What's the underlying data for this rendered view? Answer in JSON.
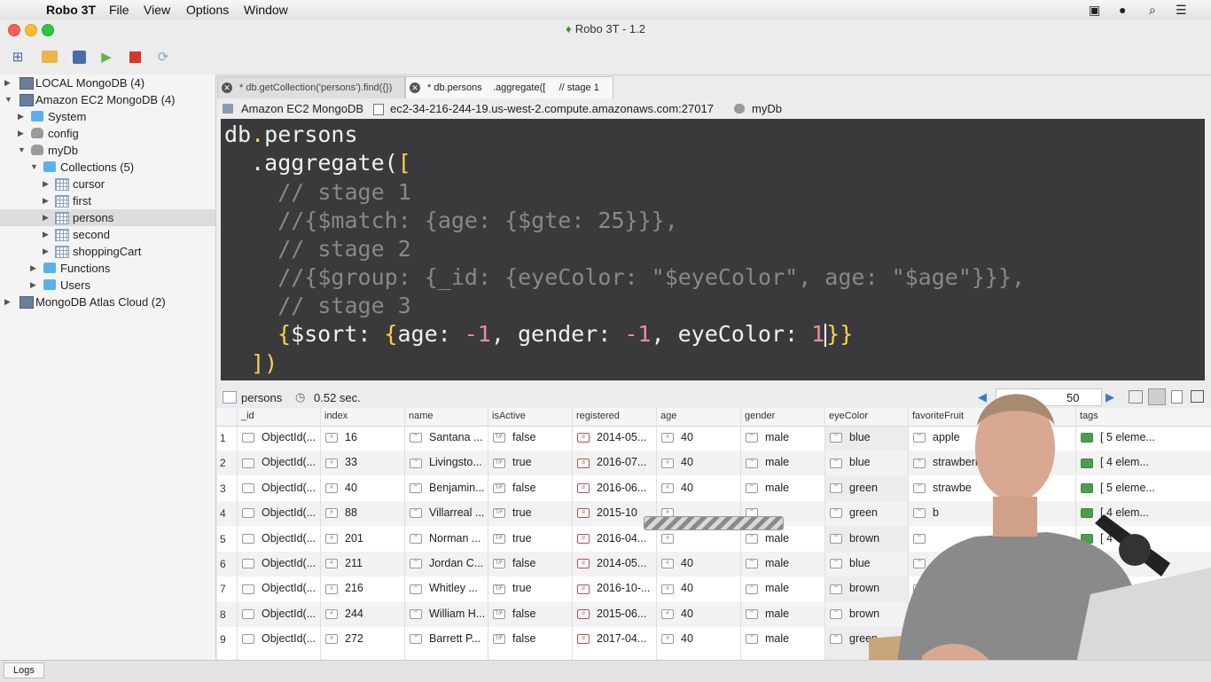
{
  "menubar": {
    "app": "Robo 3T",
    "items": [
      "File",
      "View",
      "Options",
      "Window"
    ]
  },
  "window": {
    "title": "Robo 3T - 1.2"
  },
  "toolbar": {
    "icons": [
      "connect-icon",
      "open-icon",
      "save-icon",
      "execute-icon",
      "stop-icon",
      "refresh-icon"
    ]
  },
  "sidebar": {
    "local": "LOCAL MongoDB (4)",
    "ec2": "Amazon EC2 MongoDB (4)",
    "system": "System",
    "config": "config",
    "mydb": "myDb",
    "collections": "Collections (5)",
    "cursor": "cursor",
    "first": "first",
    "persons": "persons",
    "second": "second",
    "shoppingcart": "shoppingCart",
    "functions": "Functions",
    "users": "Users",
    "atlas": "MongoDB Atlas Cloud (2)"
  },
  "tabs": {
    "tab1": "* db.getCollection('persons').find({})",
    "tab2": "* db.persons    .aggregate([     // stage 1"
  },
  "connection": {
    "server": "Amazon EC2 MongoDB",
    "host": "ec2-34-216-244-19.us-west-2.compute.amazonaws.com:27017",
    "db": "myDb"
  },
  "editor": {
    "line1a": "db",
    "line1b": ".",
    "line1c": "persons",
    "line2a": "  .aggregate(",
    "line2b": "[",
    "line3": "    // stage 1",
    "line4": "    //{$match: {age: {$gte: 25}}},",
    "line5": "    // stage 2",
    "line6": "    //{$group: {_id: {eyeColor: \"$eyeColor\", age: \"$age\"}}},",
    "line7": "    // stage 3",
    "line8a": "{",
    "line8b": "$sort: ",
    "line8c": "{",
    "line8d": "age: ",
    "line8e": "-1",
    "line8f": ", gender: ",
    "line8g": "-1",
    "line8h": ", eyeColor: ",
    "line8i": "1",
    "line8j": "}}",
    "line9": "  ])"
  },
  "status": {
    "collection": "persons",
    "time": "0.52 sec.",
    "page_size": "50"
  },
  "results": {
    "columns": [
      "_id",
      "index",
      "name",
      "isActive",
      "registered",
      "age",
      "gender",
      "eyeColor",
      "favoriteFruit",
      "tags"
    ],
    "rows": [
      {
        "n": "1",
        "id": "ObjectId(...",
        "index": "16",
        "name": "Santana ...",
        "active": "false",
        "reg": "2014-05...",
        "age": "40",
        "gender": "male",
        "eye": "blue",
        "fruit": "apple",
        "tags": "[ 5 eleme..."
      },
      {
        "n": "2",
        "id": "ObjectId(...",
        "index": "33",
        "name": "Livingsto...",
        "active": "true",
        "reg": "2016-07...",
        "age": "40",
        "gender": "male",
        "eye": "blue",
        "fruit": "strawberry",
        "tags": "[ 4 elem..."
      },
      {
        "n": "3",
        "id": "ObjectId(...",
        "index": "40",
        "name": "Benjamin...",
        "active": "false",
        "reg": "2016-06...",
        "age": "40",
        "gender": "male",
        "eye": "green",
        "fruit": "strawbe",
        "tags": "[ 5 eleme..."
      },
      {
        "n": "4",
        "id": "ObjectId(...",
        "index": "88",
        "name": "Villarreal ...",
        "active": "true",
        "reg": "2015-10",
        "age": "",
        "gender": "",
        "eye": "green",
        "fruit": "b",
        "tags": "[ 4 elem..."
      },
      {
        "n": "5",
        "id": "ObjectId(...",
        "index": "201",
        "name": "Norman ...",
        "active": "true",
        "reg": "2016-04...",
        "age": "",
        "gender": "male",
        "eye": "brown",
        "fruit": "",
        "tags": "[ 4 elem..."
      },
      {
        "n": "6",
        "id": "ObjectId(...",
        "index": "211",
        "name": "Jordan C...",
        "active": "false",
        "reg": "2014-05...",
        "age": "40",
        "gender": "male",
        "eye": "blue",
        "fruit": "",
        "tags": ""
      },
      {
        "n": "7",
        "id": "ObjectId(...",
        "index": "216",
        "name": "Whitley ...",
        "active": "true",
        "reg": "2016-10-...",
        "age": "40",
        "gender": "male",
        "eye": "brown",
        "fruit": "",
        "tags": ""
      },
      {
        "n": "8",
        "id": "ObjectId(...",
        "index": "244",
        "name": "William H...",
        "active": "false",
        "reg": "2015-06...",
        "age": "40",
        "gender": "male",
        "eye": "brown",
        "fruit": "",
        "tags": ""
      },
      {
        "n": "9",
        "id": "ObjectId(...",
        "index": "272",
        "name": "Barrett P...",
        "active": "false",
        "reg": "2017-04...",
        "age": "40",
        "gender": "male",
        "eye": "green",
        "fruit": "",
        "tags": ""
      }
    ]
  },
  "bottom": {
    "logs": "Logs"
  },
  "colors": {
    "editor_bg": "#3a3a3c",
    "keyword": "#f8d24a",
    "comment": "#888888",
    "number": "#f08aa0"
  }
}
